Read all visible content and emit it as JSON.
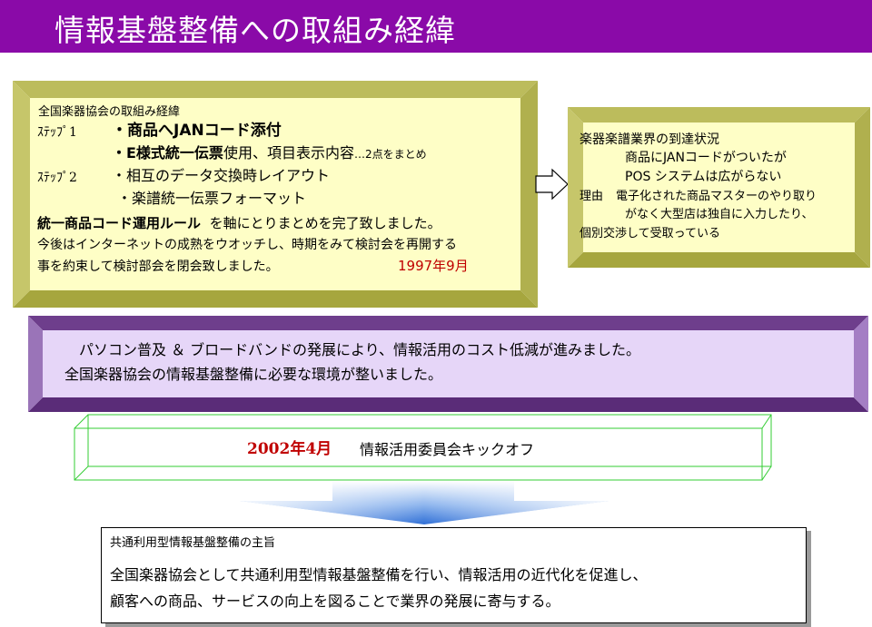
{
  "title": "情報基盤整備への取組み経緯",
  "box1": {
    "heading": "全国楽器協会の取組み経緯",
    "step1_label": "ｽﾃｯﾌﾟ1",
    "step1_line1": "・商品へJANコード添付",
    "step1_line2_bold": "・E様式統一伝票",
    "step1_line2_rest": "使用、項目表示内容",
    "step1_line2_small": "…2点をまとめ",
    "step2_label": "ｽﾃｯﾌﾟ2",
    "step2_line1": "・相互のデータ交換時レイアウト",
    "step2_line2": "・楽譜統一伝票フォーマット",
    "summary_bold": "統一商品コード運用ルール",
    "summary_rest": "を軸にとりまとめを完了致しました。",
    "note_line1": "今後はインターネットの成熟をウオッチし、時期をみて検討会を再開する",
    "note_line2": "事を約束して検討部会を閉会致しました。",
    "date": "1997年9月"
  },
  "box2": {
    "heading": "楽器楽譜業界の到達状況",
    "line1": "商品にJANコードがついたが",
    "line2": "POS システムは広がらない",
    "reason_label": "理由",
    "reason_line1": "電子化された商品マスターのやり取り",
    "reason_line2": "がなく大型店は独自に入力したり、",
    "reason_line3": "個別交渉して受取っている"
  },
  "box3": {
    "line1": "パソコン普及 ＆ ブロードバンドの発展により、情報活用のコスト低減が進みました。",
    "line2": "全国楽器協会の情報基盤整備に必要な環境が整いました。"
  },
  "kickoff": {
    "date": "2002年4月",
    "text": "情報活用委員会キックオフ"
  },
  "purpose": {
    "heading": "共通利用型情報基盤整備の主旨",
    "line1": "全国楽器協会として共通利用型情報基盤整備を行い、情報活用の近代化を促進し、",
    "line2": "顧客への商品、サービスの向上を図ることで業界の発展に寄与する。"
  },
  "colors": {
    "title_bar": "#8a0aa8",
    "date_red": "#c00000",
    "kickoff_green": "#33cc33",
    "arrow_blue": "#3a78d8"
  }
}
